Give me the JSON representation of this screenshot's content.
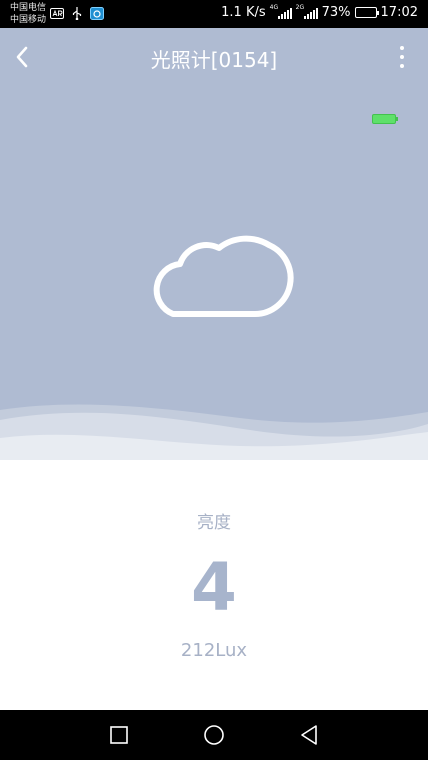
{
  "status_bar": {
    "carrier_1": "中国电信",
    "carrier_2": "中国移动",
    "speed": "1.1 K/s",
    "signal_1_network": "4G",
    "signal_2_network": "2G",
    "battery_percent": "73%",
    "time": "17:02",
    "icons": [
      "ar-icon",
      "usb-icon",
      "app-notification-icon"
    ]
  },
  "app_bar": {
    "title": "光照计[0154]",
    "back_icon": "chevron-left-icon",
    "menu_icon": "more-vertical-icon"
  },
  "device": {
    "battery_icon": "battery-icon",
    "battery_color": "#5ee06a",
    "weather_icon": "cloud-icon"
  },
  "reading": {
    "label": "亮度",
    "value": "4",
    "lux": "212Lux"
  },
  "nav_bar": {
    "recent_icon": "square-icon",
    "home_icon": "circle-icon",
    "back_icon": "triangle-back-icon"
  },
  "colors": {
    "hero_bg": "#afbbd2",
    "text_muted": "#a7b1c6"
  }
}
